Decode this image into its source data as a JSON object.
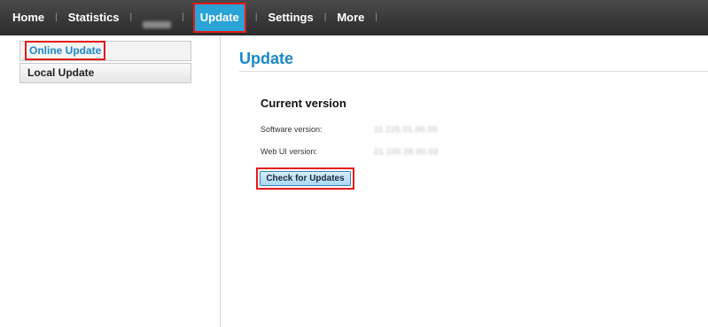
{
  "nav": {
    "items": [
      {
        "label": "Home"
      },
      {
        "label": "Statistics"
      },
      {
        "label": ""
      },
      {
        "label": "Update"
      },
      {
        "label": "Settings"
      },
      {
        "label": "More"
      }
    ],
    "active": "Update",
    "colors": {
      "bar": "#333333",
      "active_bg": "#2aa3d6",
      "highlight": "#e21b1b"
    }
  },
  "sidebar": {
    "items": [
      {
        "label": "Online Update"
      },
      {
        "label": "Local Update"
      }
    ],
    "selected": "Online Update"
  },
  "main": {
    "title": "Update",
    "section_title": "Current version",
    "software_version_label": "Software version:",
    "software_version_value": "11.225.01.00.00",
    "webui_version_label": "Web UI version:",
    "webui_version_value": "21.100.28.00.03",
    "check_button_label": "Check for Updates",
    "accent_color": "#1a88c9"
  }
}
